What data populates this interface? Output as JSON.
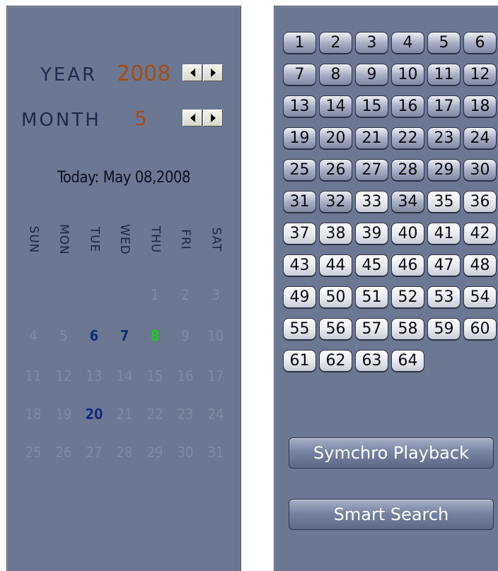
{
  "calendar": {
    "year_label": "YEAR",
    "year_value": "2008",
    "month_label": "MONTH",
    "month_value": "5",
    "today_text": "Today: May 08,2008",
    "weekdays": [
      "SUN",
      "MON",
      "TUE",
      "WED",
      "THU",
      "FRI",
      "SAT"
    ],
    "days": [
      "1",
      "2",
      "3",
      "4",
      "5",
      "6",
      "7",
      "8",
      "9",
      "10",
      "11",
      "12",
      "13",
      "14",
      "15",
      "16",
      "17",
      "18",
      "19",
      "20",
      "21",
      "22",
      "23",
      "24",
      "25",
      "26",
      "27",
      "28",
      "29",
      "30",
      "31"
    ],
    "first_weekday_index": 4,
    "recorded_days": [
      "6",
      "7",
      "20"
    ],
    "today_day": "8",
    "arrow_left_icon": "arrow-left-icon",
    "arrow_right_icon": "arrow-right-icon"
  },
  "channels": {
    "labels": [
      "1",
      "2",
      "3",
      "4",
      "5",
      "6",
      "7",
      "8",
      "9",
      "10",
      "11",
      "12",
      "13",
      "14",
      "15",
      "16",
      "17",
      "18",
      "19",
      "20",
      "21",
      "22",
      "23",
      "24",
      "25",
      "26",
      "27",
      "28",
      "29",
      "30",
      "31",
      "32",
      "33",
      "34",
      "35",
      "36",
      "37",
      "38",
      "39",
      "40",
      "41",
      "42",
      "43",
      "44",
      "45",
      "46",
      "47",
      "48",
      "49",
      "50",
      "51",
      "52",
      "53",
      "54",
      "55",
      "56",
      "57",
      "58",
      "59",
      "60",
      "61",
      "62",
      "63",
      "64"
    ],
    "active": [
      "1",
      "2",
      "3",
      "4",
      "5",
      "6",
      "7",
      "8",
      "9",
      "10",
      "11",
      "12",
      "13",
      "14",
      "15",
      "16",
      "17",
      "18",
      "19",
      "20",
      "21",
      "22",
      "23",
      "24",
      "25",
      "26",
      "27",
      "28",
      "29",
      "30",
      "31",
      "32",
      "34"
    ]
  },
  "actions": {
    "sync_playback_label": "Symchro Playback",
    "smart_search_label": "Smart Search"
  },
  "colors": {
    "panel_bg": "#6c7793",
    "year_month_value": "#a34d14",
    "recorded_day": "#142b78",
    "today_day": "#14d018",
    "empty_day": "#828aa0"
  }
}
